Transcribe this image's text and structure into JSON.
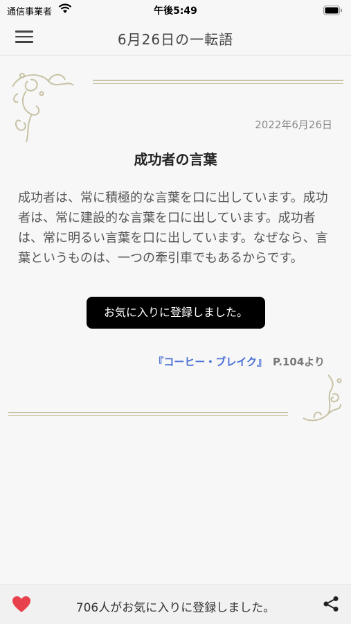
{
  "status_bar": {
    "carrier": "通信事業者",
    "time": "午後5:49"
  },
  "nav": {
    "title": "6月26日の一転語",
    "menu_icon": "hamburger-menu-icon"
  },
  "article": {
    "date": "2022年6月26日",
    "title": "成功者の言葉",
    "body": "成功者は、常に積極的な言葉を口に出しています。成功者は、常に建設的な言葉を口に出しています。成功者は、常に明るい言葉を口に出しています。なぜなら、言葉というものは、一つの牽引車でもあるからです。",
    "source_book": "『コーヒー・ブレイク』",
    "source_page": "P.104より"
  },
  "toast": {
    "message": "お気に入りに登録しました。"
  },
  "bottom_bar": {
    "favorite_count_text": "706人がお気に入りに登録しました。",
    "heart_icon": "heart-icon",
    "share_icon": "share-icon",
    "heart_color": "#e8414b"
  }
}
